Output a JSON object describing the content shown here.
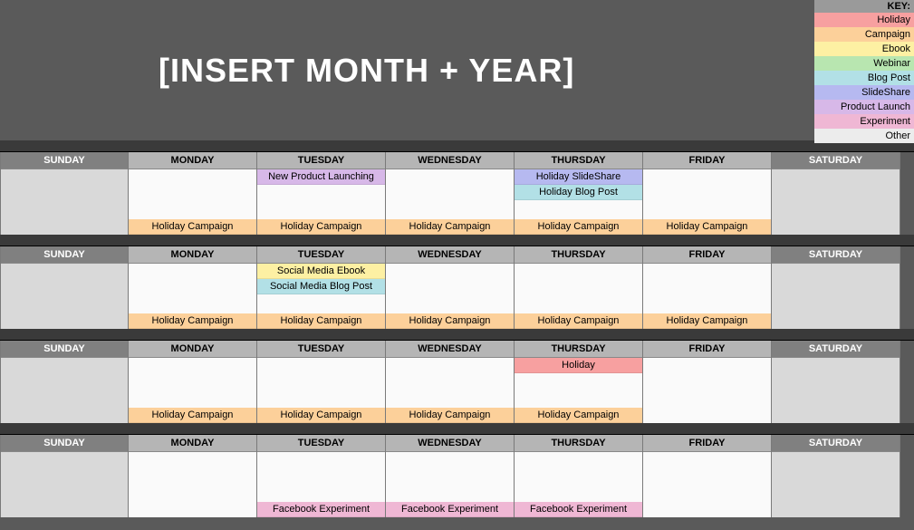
{
  "title": "[INSERT MONTH + YEAR]",
  "key": {
    "header": "KEY:",
    "items": [
      {
        "label": "Holiday",
        "color": "#f7a0a0"
      },
      {
        "label": "Campaign",
        "color": "#fcd09a"
      },
      {
        "label": "Ebook",
        "color": "#fdf0a3"
      },
      {
        "label": "Webinar",
        "color": "#b8e6b0"
      },
      {
        "label": "Blog Post",
        "color": "#b2e0e6"
      },
      {
        "label": "SlideShare",
        "color": "#b6b9f0"
      },
      {
        "label": "Product Launch",
        "color": "#d7b8e8"
      },
      {
        "label": "Experiment",
        "color": "#efb7d4"
      },
      {
        "label": "Other",
        "color": "#ececec"
      }
    ]
  },
  "dayNames": [
    "SUNDAY",
    "MONDAY",
    "TUESDAY",
    "WEDNESDAY",
    "THURSDAY",
    "FRIDAY",
    "SATURDAY"
  ],
  "weeks": [
    {
      "days": [
        {
          "top": [],
          "bottom": []
        },
        {
          "top": [],
          "bottom": [
            {
              "label": "Holiday Campaign",
              "color": "#fcd09a"
            }
          ]
        },
        {
          "top": [
            {
              "label": "New Product Launching",
              "color": "#d7b8e8"
            }
          ],
          "bottom": [
            {
              "label": "Holiday Campaign",
              "color": "#fcd09a"
            }
          ]
        },
        {
          "top": [],
          "bottom": [
            {
              "label": "Holiday Campaign",
              "color": "#fcd09a"
            }
          ]
        },
        {
          "top": [
            {
              "label": "Holiday SlideShare",
              "color": "#b6b9f0"
            },
            {
              "label": "Holiday Blog Post",
              "color": "#b2e0e6"
            }
          ],
          "bottom": [
            {
              "label": "Holiday Campaign",
              "color": "#fcd09a"
            }
          ]
        },
        {
          "top": [],
          "bottom": [
            {
              "label": "Holiday Campaign",
              "color": "#fcd09a"
            }
          ]
        },
        {
          "top": [],
          "bottom": []
        }
      ]
    },
    {
      "days": [
        {
          "top": [],
          "bottom": []
        },
        {
          "top": [],
          "bottom": [
            {
              "label": "Holiday Campaign",
              "color": "#fcd09a"
            }
          ]
        },
        {
          "top": [
            {
              "label": "Social Media Ebook",
              "color": "#fdf0a3"
            },
            {
              "label": "Social Media Blog Post",
              "color": "#b2e0e6"
            }
          ],
          "bottom": [
            {
              "label": "Holiday Campaign",
              "color": "#fcd09a"
            }
          ]
        },
        {
          "top": [],
          "bottom": [
            {
              "label": "Holiday Campaign",
              "color": "#fcd09a"
            }
          ]
        },
        {
          "top": [],
          "bottom": [
            {
              "label": "Holiday Campaign",
              "color": "#fcd09a"
            }
          ]
        },
        {
          "top": [],
          "bottom": [
            {
              "label": "Holiday Campaign",
              "color": "#fcd09a"
            }
          ]
        },
        {
          "top": [],
          "bottom": []
        }
      ]
    },
    {
      "days": [
        {
          "top": [],
          "bottom": []
        },
        {
          "top": [],
          "bottom": [
            {
              "label": "Holiday Campaign",
              "color": "#fcd09a"
            }
          ]
        },
        {
          "top": [],
          "bottom": [
            {
              "label": "Holiday Campaign",
              "color": "#fcd09a"
            }
          ]
        },
        {
          "top": [],
          "bottom": [
            {
              "label": "Holiday Campaign",
              "color": "#fcd09a"
            }
          ]
        },
        {
          "top": [
            {
              "label": "Holiday",
              "color": "#f7a0a0"
            }
          ],
          "bottom": [
            {
              "label": "Holiday Campaign",
              "color": "#fcd09a"
            }
          ]
        },
        {
          "top": [],
          "bottom": []
        },
        {
          "top": [],
          "bottom": []
        }
      ]
    },
    {
      "days": [
        {
          "top": [],
          "bottom": []
        },
        {
          "top": [],
          "bottom": []
        },
        {
          "top": [],
          "bottom": [
            {
              "label": "Facebook Experiment",
              "color": "#efb7d4"
            }
          ]
        },
        {
          "top": [],
          "bottom": [
            {
              "label": "Facebook Experiment",
              "color": "#efb7d4"
            }
          ]
        },
        {
          "top": [],
          "bottom": [
            {
              "label": "Facebook Experiment",
              "color": "#efb7d4"
            }
          ]
        },
        {
          "top": [],
          "bottom": []
        },
        {
          "top": [],
          "bottom": []
        }
      ]
    }
  ]
}
